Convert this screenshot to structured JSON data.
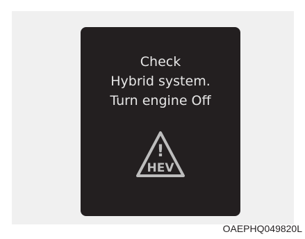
{
  "display": {
    "message_lines": [
      "Check",
      "Hybrid system.",
      "Turn engine Off"
    ],
    "warning_icon": {
      "name": "hev-warning-triangle-icon",
      "symbol": "!",
      "label": "HEV"
    }
  },
  "caption": "OAEPHQ049820L",
  "colors": {
    "display_background": "#231f20",
    "display_text": "#e6e6e6",
    "panel_background": "#f0f0f0",
    "icon_stroke": "#bdbdbd"
  }
}
